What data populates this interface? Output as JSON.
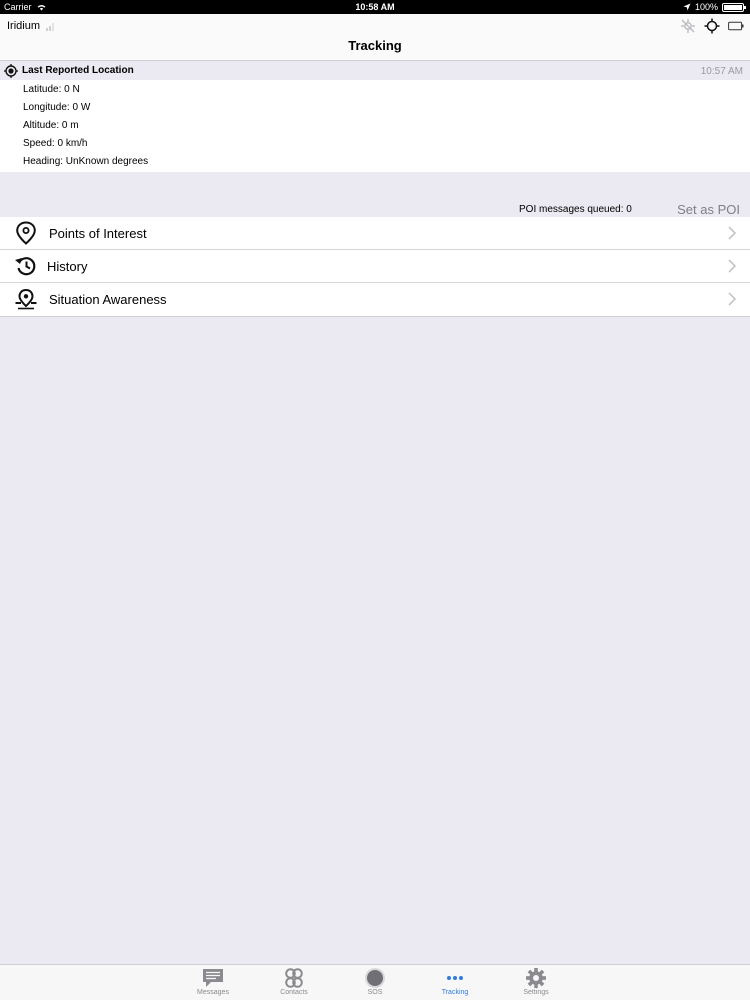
{
  "status_bar": {
    "carrier": "Carrier",
    "time": "10:58 AM",
    "battery": "100%"
  },
  "nav": {
    "network": "Iridium",
    "title": "Tracking"
  },
  "location": {
    "header": "Last Reported Location",
    "time": "10:57 AM",
    "latitude": "Latitude: 0 N",
    "longitude": "Longitude: 0 W",
    "altitude": "Altitude: 0 m",
    "speed": "Speed: 0 km/h",
    "heading": "Heading: UnKnown degrees"
  },
  "poi": {
    "queued": "POI messages queued: 0",
    "set_label": "Set as POI"
  },
  "menu": [
    {
      "label": "Points of Interest",
      "icon": "map-pin-icon"
    },
    {
      "label": "History",
      "icon": "history-icon"
    },
    {
      "label": "Situation Awareness",
      "icon": "situation-awareness-icon"
    }
  ],
  "tabs": [
    {
      "label": "Messages",
      "icon": "messages-icon"
    },
    {
      "label": "Contacts",
      "icon": "contacts-icon"
    },
    {
      "label": "SOS",
      "icon": "sos-icon"
    },
    {
      "label": "Tracking",
      "icon": "more-dots-icon"
    },
    {
      "label": "Settings",
      "icon": "gear-icon"
    }
  ],
  "colors": {
    "accent": "#2f7cdb",
    "background": "#ebe9f1",
    "tab_inactive": "#8a8a8f"
  }
}
